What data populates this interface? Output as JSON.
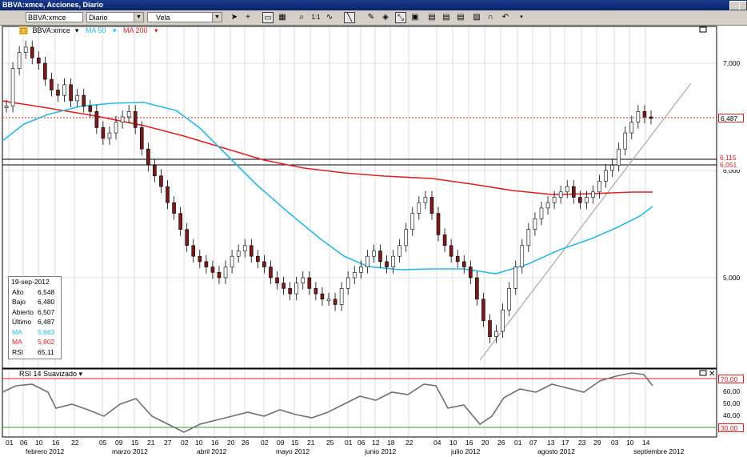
{
  "window": {
    "title": "BBVA:xmce, Acciones, Diario"
  },
  "toolbar": {
    "symbol": "BBVA:xmce",
    "period": "Diario",
    "chart_type": "Vela",
    "tools": [
      "cursor-icon",
      "crosshair-icon",
      "window-icon",
      "grid-icon",
      "zoom-icon",
      "one-to-one-icon",
      "wave-icon",
      "trendline-icon",
      "pencil-icon",
      "paint-icon",
      "magnet-icon",
      "image1-icon",
      "image2-icon",
      "image3-icon",
      "image4-icon",
      "magnet2-icon",
      "undo-icon"
    ]
  },
  "legend": {
    "symbol": "BBVA:xmce",
    "ma50": "MA 50",
    "ma200": "MA 200",
    "colors": {
      "ma50": "#29b8e8",
      "ma200": "#e02020",
      "up": "#ffffff",
      "down": "#7a1a1a",
      "rsi": "#707070"
    }
  },
  "info": {
    "date": "19-sep-2012",
    "rows": [
      {
        "label": "Alto",
        "value": "6,548"
      },
      {
        "label": "Bajo",
        "value": "6,480"
      },
      {
        "label": "Abierto",
        "value": "6,507"
      },
      {
        "label": "Último",
        "value": "6,487"
      },
      {
        "label": "MA",
        "value": "5,663"
      },
      {
        "label": "MA",
        "value": "5,802"
      },
      {
        "label": "RSI",
        "value": "65,11"
      }
    ]
  },
  "price_axis": {
    "labels": [
      "7,000",
      "6,000",
      "5,000"
    ],
    "tags": {
      "last": "6,487",
      "upper": "6,115",
      "lower": "6,051"
    }
  },
  "rsi": {
    "label": "RSI 14 Suavizado",
    "axis": [
      "70,00",
      "60,00",
      "50,00",
      "40,00",
      "30,00"
    ],
    "levels": {
      "top": "70,00",
      "bottom": "30,00"
    }
  },
  "x_axis": {
    "days": [
      "01",
      "06",
      "10",
      "16",
      "22",
      "05",
      "09",
      "15",
      "21",
      "27",
      "02",
      "10",
      "16",
      "20",
      "26",
      "02",
      "09",
      "15",
      "21",
      "25",
      "01",
      "06",
      "12",
      "18",
      "22",
      "04",
      "10",
      "16",
      "20",
      "26",
      "01",
      "07",
      "13",
      "17",
      "23",
      "29",
      "03",
      "10",
      "14"
    ],
    "months": [
      "febrero 2012",
      "marzo 2012",
      "abril 2012",
      "mayo 2012",
      "junio 2012",
      "julio 2012",
      "agosto 2012",
      "septiembre 2012"
    ]
  }
}
